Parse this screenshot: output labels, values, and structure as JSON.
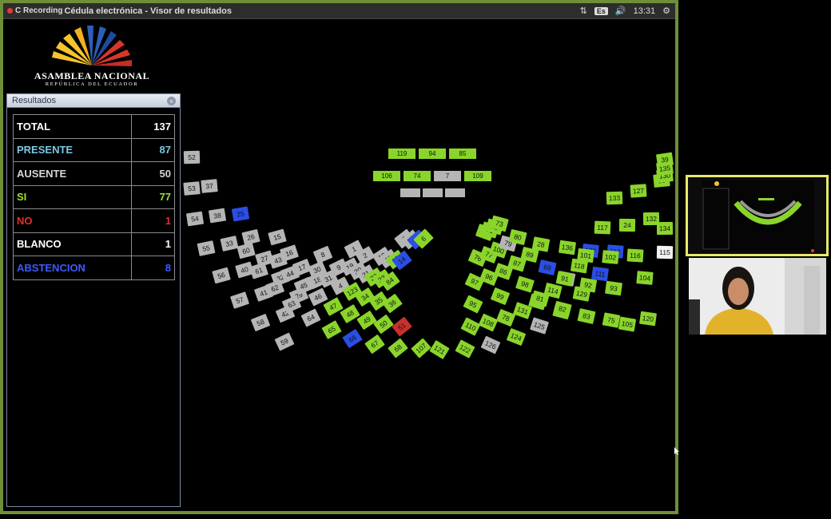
{
  "window": {
    "title_prefix": "C Recording",
    "title": "Cédula electrónica - Visor de resultados",
    "lang": "Es",
    "volume_icon": "speaker-icon",
    "time": "13:31",
    "settings_icon": "gear-icon",
    "network_icon": "network-arrows-icon"
  },
  "logo": {
    "title": "ASAMBLEA NACIONAL",
    "subtitle": "REPÚBLICA DEL ECUADOR"
  },
  "results": {
    "header": "Resultados",
    "rows": [
      {
        "label": "TOTAL",
        "value": "137",
        "color": "#ffffff"
      },
      {
        "label": "PRESENTE",
        "value": "87",
        "color": "#7ec8e3"
      },
      {
        "label": "AUSENTE",
        "value": "50",
        "color": "#d8d8d8"
      },
      {
        "label": "SI",
        "value": "77",
        "color": "#9ee02f"
      },
      {
        "label": "NO",
        "value": "1",
        "color": "#e0322b"
      },
      {
        "label": "BLANCO",
        "value": "1",
        "color": "#ffffff"
      },
      {
        "label": "ABSTENCION",
        "value": "8",
        "color": "#3b5bff"
      }
    ]
  },
  "colors": {
    "si": "#8ad52b",
    "ausente": "#b5b5b5",
    "abstencion": "#2b4ee3",
    "no": "#c9302c",
    "blanco": "#f2f2f2",
    "frame": "#6f8f37"
  },
  "top_rows": [
    [
      "119",
      "94",
      "85"
    ],
    [
      "106",
      "74",
      "7",
      "109"
    ]
  ],
  "seats": {
    "left": [
      [
        "52",
        "53",
        "54",
        "55",
        "56",
        "57",
        "58",
        "59"
      ],
      [
        "37",
        "38",
        "33",
        "40",
        "41",
        "42"
      ],
      [
        "25",
        "26",
        "27",
        "32",
        "29"
      ],
      [
        "15",
        "16",
        "17",
        "18"
      ],
      [
        "8",
        "9"
      ],
      [
        "1",
        "2"
      ],
      [
        "60",
        "61",
        "62",
        "63",
        "64",
        "65",
        "66",
        "67",
        "68",
        "107"
      ],
      [
        "43",
        "44",
        "45",
        "46",
        "47",
        "48",
        "49",
        "50",
        "51"
      ],
      [
        "30",
        "31",
        "4",
        "123",
        "34",
        "35",
        "36"
      ],
      [
        "19",
        "20",
        "21",
        "22",
        "23",
        "84"
      ],
      [
        "10",
        "11",
        "13",
        "14"
      ],
      [
        "3",
        "12",
        "5",
        "6"
      ]
    ],
    "right": [
      [
        "121",
        "122",
        "126",
        "124",
        "125",
        "128",
        "129",
        "111",
        "112"
      ],
      [
        "110",
        "108",
        "78",
        "131",
        "113",
        "114",
        "103",
        "118",
        "137"
      ],
      [
        "95",
        "99",
        "98",
        "69",
        "136"
      ],
      [
        "97",
        "96",
        "86",
        "87",
        "89",
        "28"
      ],
      [
        "76",
        "77",
        "100",
        "79",
        "80"
      ],
      [
        "70",
        "71",
        "72",
        "73"
      ],
      [
        "81",
        "91",
        "101",
        "117",
        "133"
      ],
      [
        "82",
        "92",
        "102",
        "24",
        "127"
      ],
      [
        "83",
        "93",
        "116",
        "132",
        "88"
      ],
      [
        "75",
        "104",
        "134",
        "130"
      ],
      [
        "105",
        "115",
        "135"
      ],
      [
        "120",
        "39"
      ]
    ],
    "status": {
      "25": "abstencion",
      "5": "abstencion",
      "14": "abstencion",
      "66": "abstencion",
      "69": "abstencion",
      "137": "abstencion",
      "112": "abstencion",
      "111": "abstencion",
      "51": "no",
      "115": "blanco",
      "6": "si",
      "13": "si",
      "22": "si",
      "23": "si",
      "84": "si",
      "123": "si",
      "34": "si",
      "35": "si",
      "36": "si",
      "47": "si",
      "48": "si",
      "49": "si",
      "50": "si",
      "65": "si",
      "67": "si",
      "68": "si",
      "107": "si",
      "70": "si",
      "71": "si",
      "72": "si",
      "73": "si",
      "76": "si",
      "77": "si",
      "100": "si",
      "80": "si",
      "97": "si",
      "96": "si",
      "86": "si",
      "87": "si",
      "89": "si",
      "28": "si",
      "95": "si",
      "99": "si",
      "98": "si",
      "136": "si",
      "110": "si",
      "108": "si",
      "78": "si",
      "131": "si",
      "113": "si",
      "114": "si",
      "118": "si",
      "121": "si",
      "122": "si",
      "124": "si",
      "128": "si",
      "129": "si",
      "81": "si",
      "91": "si",
      "101": "si",
      "117": "si",
      "133": "si",
      "82": "si",
      "92": "si",
      "102": "si",
      "24": "si",
      "127": "si",
      "83": "si",
      "93": "si",
      "116": "si",
      "132": "si",
      "88": "si",
      "75": "si",
      "104": "si",
      "134": "si",
      "130": "si",
      "105": "si",
      "135": "si",
      "120": "si",
      "39": "si",
      "119": "si",
      "94": "si",
      "85": "si",
      "106": "si",
      "74": "si",
      "109": "si"
    }
  }
}
